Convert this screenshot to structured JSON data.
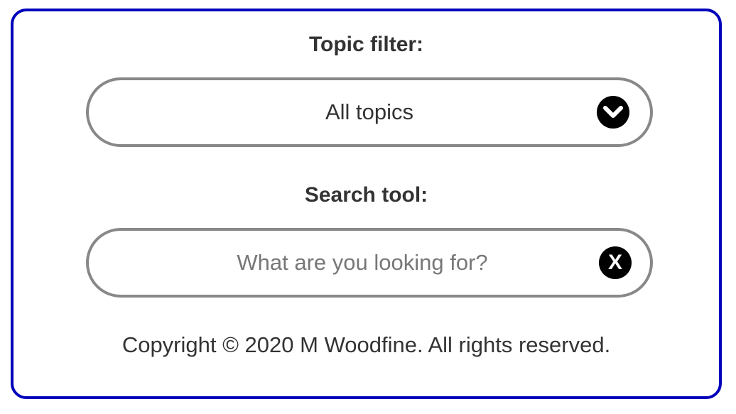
{
  "topic_filter": {
    "label": "Topic filter:",
    "selected": "All topics",
    "toggle_icon": "chevron-down-circle-icon"
  },
  "search_tool": {
    "label": "Search tool:",
    "value": "",
    "placeholder": "What are you looking for?",
    "clear_label": "X",
    "clear_icon": "clear-icon"
  },
  "footer": {
    "copyright": "Copyright © 2020 M Woodfine. All rights reserved."
  },
  "colors": {
    "panel_border": "#0000bb",
    "pill_border": "#888888",
    "text": "#333333",
    "button_bg": "#000000"
  }
}
